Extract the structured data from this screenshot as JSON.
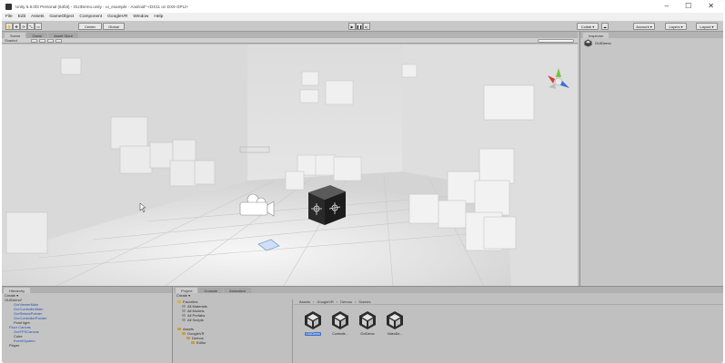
{
  "window": {
    "title": "Unity 5.6.0f3 Personal (64bit) - GUIDemo.unity - ui_example - Android* <DX11 on DX9 GPU>",
    "controls": [
      "–",
      "☐",
      "✕"
    ]
  },
  "menu": [
    "File",
    "Edit",
    "Assets",
    "GameObject",
    "Component",
    "GoogleVR",
    "Window",
    "Help"
  ],
  "toolbar": {
    "pivot": "Center",
    "space": "Global",
    "play_icon": "play-icon",
    "pause_icon": "pause-icon",
    "step_icon": "step-icon",
    "collab": "Collab ▾",
    "account": "Account ▾",
    "layers": "Layers ▾",
    "layout": "Layout ▾"
  },
  "scene": {
    "tabs": [
      "Scene",
      "Game",
      "Asset Store"
    ],
    "shading": "Shaded",
    "gizmo_icon": "axis-gizmo-icon"
  },
  "inspector": {
    "tab": "Inspector",
    "object_name": "GUIDemo"
  },
  "hierarchy": {
    "tab": "Hierarchy",
    "create": "Create ▾",
    "items": [
      {
        "label": "GUIDemo*",
        "indent": 0,
        "blue": false
      },
      {
        "label": "GvrViewerMain",
        "indent": 2,
        "blue": true
      },
      {
        "label": "GvrControllerMain",
        "indent": 2,
        "blue": true
      },
      {
        "label": "GvrReticlePointer",
        "indent": 2,
        "blue": true
      },
      {
        "label": "GvrControllerPointer",
        "indent": 2,
        "blue": true
      },
      {
        "label": "Point light",
        "indent": 2,
        "blue": false
      },
      {
        "label": "Floor Canvas",
        "indent": 1,
        "blue": true
      },
      {
        "label": "GvrFPSCanvas",
        "indent": 2,
        "blue": true
      },
      {
        "label": "Cube",
        "indent": 2,
        "blue": false
      },
      {
        "label": "EventSystem",
        "indent": 2,
        "blue": true
      },
      {
        "label": "Player",
        "indent": 1,
        "blue": false
      }
    ]
  },
  "project": {
    "tabs": [
      "Project",
      "Console",
      "Animation"
    ],
    "create": "Create ▾",
    "tree": [
      {
        "label": "Favorites",
        "indent": 0,
        "type": "star"
      },
      {
        "label": "All Materials",
        "indent": 1,
        "type": "search"
      },
      {
        "label": "All Models",
        "indent": 1,
        "type": "search"
      },
      {
        "label": "All Prefabs",
        "indent": 1,
        "type": "search"
      },
      {
        "label": "All Scripts",
        "indent": 1,
        "type": "search"
      },
      {
        "label": "",
        "indent": 0,
        "type": "blank"
      },
      {
        "label": "Assets",
        "indent": 0,
        "type": "folder"
      },
      {
        "label": "GoogleVR",
        "indent": 1,
        "type": "folder"
      },
      {
        "label": "Demos",
        "indent": 2,
        "type": "folder"
      },
      {
        "label": "Editor",
        "indent": 3,
        "type": "folder"
      }
    ],
    "breadcrumb": [
      "Assets",
      "GoogleVR",
      "Demos",
      "Scenes"
    ],
    "assets": [
      {
        "label": "GUIDemo",
        "selected": true
      },
      {
        "label": "Controlle...",
        "selected": false
      },
      {
        "label": "GvrDemo",
        "selected": false
      },
      {
        "label": "VideoDe...",
        "selected": false
      }
    ]
  }
}
